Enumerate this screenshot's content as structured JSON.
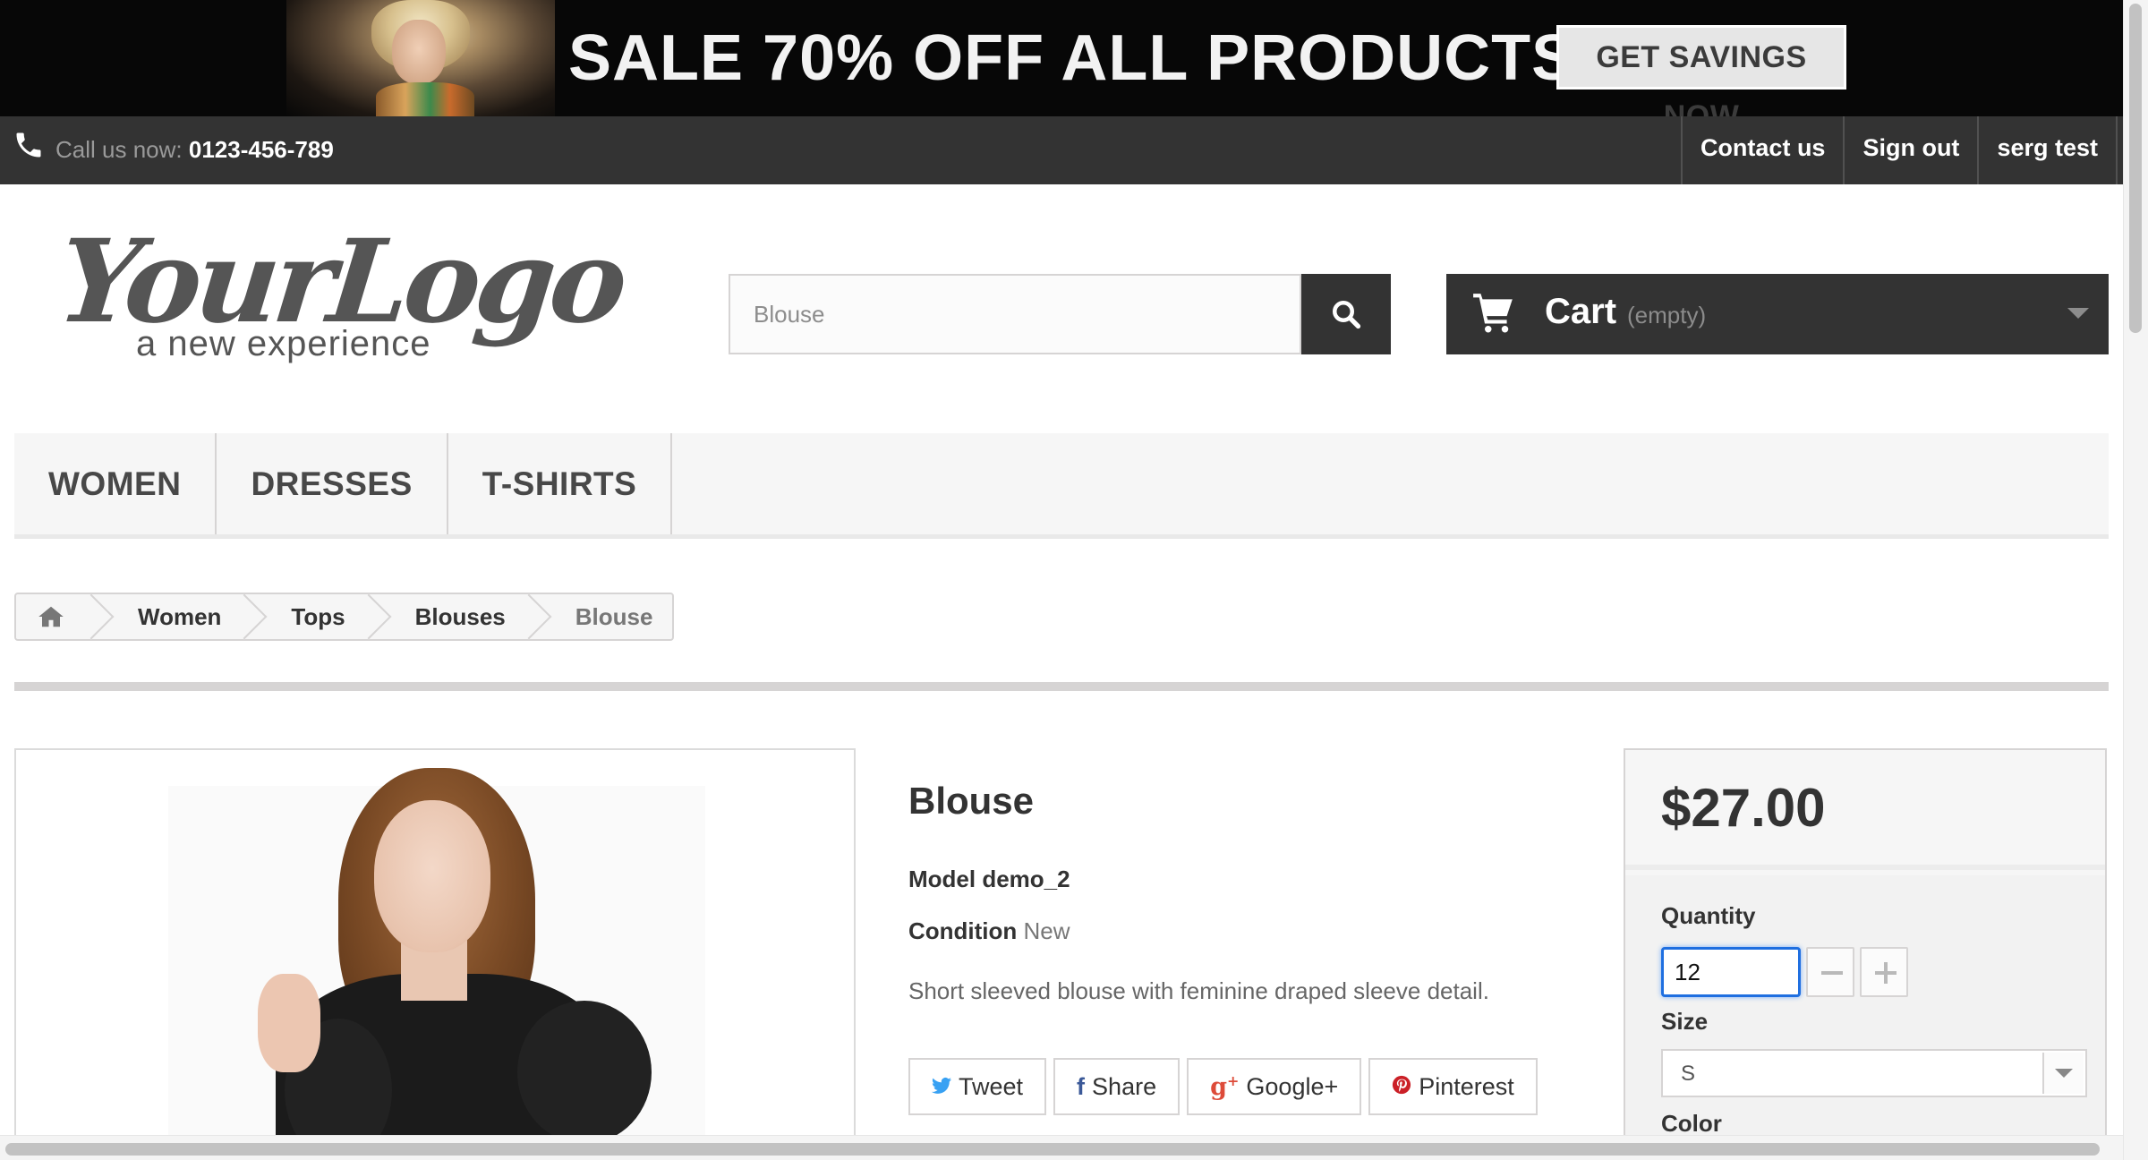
{
  "banner": {
    "headline": "SALE 70% OFF ALL PRODUCTS",
    "cta_label": "GET SAVINGS NOW"
  },
  "topbar": {
    "call_prefix": "Call us now:",
    "phone": "0123-456-789",
    "links": [
      "Contact us",
      "Sign out",
      "serg test"
    ],
    "background": "#333333"
  },
  "header": {
    "logo_main": "YourLogo",
    "logo_tagline": "a new experience",
    "search": {
      "value": "Blouse",
      "icon": "search-icon"
    },
    "cart": {
      "label": "Cart",
      "status": "(empty)",
      "icon": "cart-icon"
    }
  },
  "menu": {
    "items": [
      "WOMEN",
      "DRESSES",
      "T-SHIRTS"
    ]
  },
  "breadcrumb": {
    "home_icon": "home-icon",
    "items": [
      "Women",
      "Tops",
      "Blouses"
    ],
    "current": "Blouse"
  },
  "product": {
    "name": "Blouse",
    "model": "Model demo_2",
    "condition_label": "Condition",
    "condition_value": "New",
    "description": "Short sleeved blouse with feminine draped sleeve detail.",
    "social": [
      {
        "label": "Tweet",
        "icon": "twitter-icon"
      },
      {
        "label": "Share",
        "icon": "facebook-icon"
      },
      {
        "label": "Google+",
        "icon": "google-plus-icon"
      },
      {
        "label": "Pinterest",
        "icon": "pinterest-icon"
      }
    ]
  },
  "buybox": {
    "price": "$27.00",
    "quantity_label": "Quantity",
    "quantity_value": "12",
    "size_label": "Size",
    "size_selected": "S",
    "color_label": "Color"
  },
  "colors": {
    "dark": "#333333",
    "focus": "#1f6fe0",
    "border": "#d6d4d4"
  }
}
